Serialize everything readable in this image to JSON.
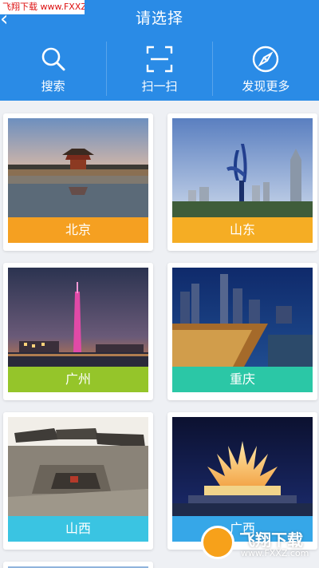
{
  "watermark": {
    "text": "飞翔下载 www.FXXZ.com"
  },
  "header": {
    "title": "请选择",
    "back_icon": "chevron-left-icon"
  },
  "tools": [
    {
      "label": "搜索",
      "icon": "search-icon"
    },
    {
      "label": "扫一扫",
      "icon": "scan-icon"
    },
    {
      "label": "发现更多",
      "icon": "compass-icon"
    }
  ],
  "cities": [
    {
      "label": "北京",
      "color": "#f5a021"
    },
    {
      "label": "山东",
      "color": "#f5ad24"
    },
    {
      "label": "广州",
      "color": "#95c52a"
    },
    {
      "label": "重庆",
      "color": "#2bc7a6"
    },
    {
      "label": "山西",
      "color": "#3ac4e2"
    },
    {
      "label": "广西",
      "color": "#36a7e8"
    }
  ],
  "colors": {
    "header_bg": "#2a8be6",
    "page_bg": "#eef0f4"
  },
  "brand_overlay": {
    "text": "飞翔下载",
    "sub": "www.FXXZ.com"
  }
}
